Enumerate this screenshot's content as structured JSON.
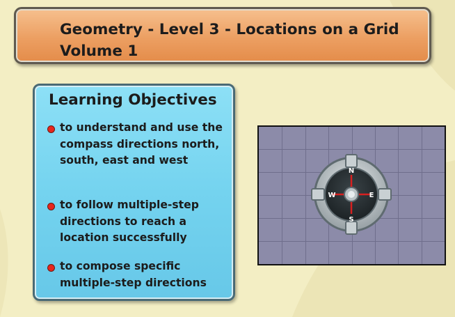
{
  "title": {
    "line1": "Geometry - Level 3 - Locations on a Grid",
    "line2": "Volume 1"
  },
  "objectives": {
    "heading": "Learning Objectives",
    "items": [
      "to understand and use the compass directions north, south, east and west",
      "to follow multiple-step directions to reach a location successfully",
      "to compose specific multiple-step directions"
    ]
  },
  "compass": {
    "n": "N",
    "s": "S",
    "e": "E",
    "w": "W"
  },
  "colors": {
    "background": "#f3eec4",
    "title_box": "#ec9f62",
    "objectives_box": "#74d3ef",
    "grid": "#8c8ba9",
    "bullet": "#e8261c",
    "compass_needle": "#d62020"
  }
}
